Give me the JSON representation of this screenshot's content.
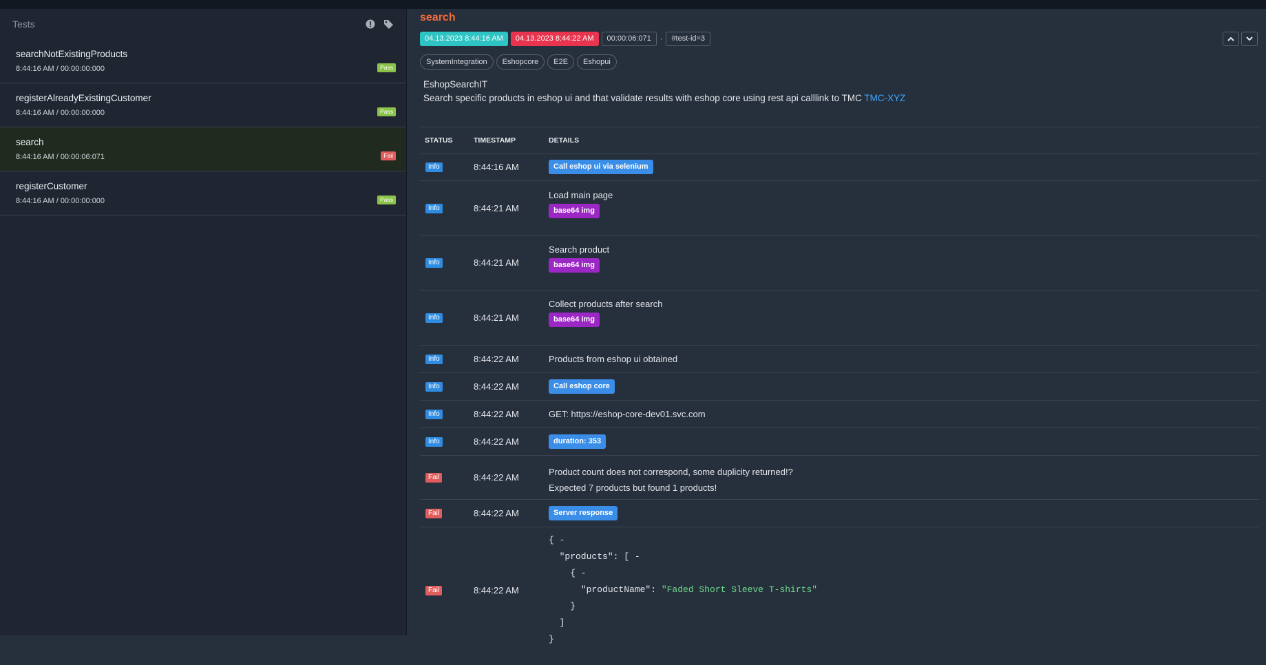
{
  "sidebar": {
    "title": "Tests",
    "icons": [
      "exclamation-circle-icon",
      "tag-icon"
    ],
    "tests": [
      {
        "name": "searchNotExistingProducts",
        "time": "8:44:16 AM / 00:00:00:000",
        "status": "Pass"
      },
      {
        "name": "registerAlreadyExistingCustomer",
        "time": "8:44:16 AM / 00:00:00:000",
        "status": "Pass"
      },
      {
        "name": "search",
        "time": "8:44:16 AM / 00:00:06:071",
        "status": "Fail"
      },
      {
        "name": "registerCustomer",
        "time": "8:44:16 AM / 00:00:00:000",
        "status": "Pass"
      }
    ]
  },
  "test": {
    "title": "search",
    "start": "04.13.2023 8:44:16 AM",
    "end": "04.13.2023 8:44:22 AM",
    "duration": "00:00:06:071",
    "separator": "·",
    "test_id": "#test-id=3",
    "tags": [
      "SystemIntegration",
      "Eshopcore",
      "E2E",
      "Eshopui"
    ],
    "class_name": "EshopSearchIT",
    "description": "Search specific products in eshop ui and that validate results with eshop core using rest api calllink to TMC ",
    "link_text": "TMC-XYZ"
  },
  "log": {
    "headers": {
      "status": "STATUS",
      "timestamp": "TIMESTAMP",
      "details": "DETAILS"
    },
    "rows": [
      {
        "status": "Info",
        "ts": "8:44:16 AM",
        "button": "Call eshop ui via selenium"
      },
      {
        "status": "Info",
        "ts": "8:44:21 AM",
        "text": "Load main page",
        "purple": "base64 img"
      },
      {
        "status": "Info",
        "ts": "8:44:21 AM",
        "text": "Search product",
        "purple": "base64 img"
      },
      {
        "status": "Info",
        "ts": "8:44:21 AM",
        "text": "Collect products after search",
        "purple": "base64 img"
      },
      {
        "status": "Info",
        "ts": "8:44:22 AM",
        "text": "Products from eshop ui obtained"
      },
      {
        "status": "Info",
        "ts": "8:44:22 AM",
        "button": "Call eshop core"
      },
      {
        "status": "Info",
        "ts": "8:44:22 AM",
        "text": "GET: https://eshop-core-dev01.svc.com"
      },
      {
        "status": "Info",
        "ts": "8:44:22 AM",
        "button": "duration: 353"
      },
      {
        "status": "Fail",
        "ts": "8:44:22 AM",
        "text": "Product count does not correspond, some duplicity returned!?",
        "text2": "Expected 7 products but found 1 products!"
      },
      {
        "status": "Fail",
        "ts": "8:44:22 AM",
        "button": "Server response"
      },
      {
        "status": "Fail",
        "ts": "8:44:22 AM",
        "json": {
          "l1": "{ -",
          "l2": "  \"products\": [ -",
          "l3": "    { -",
          "l4_key": "      \"productName\": ",
          "l4_val": "\"Faded Short Sleeve T-shirts\"",
          "l5": "    }",
          "l6": "  ]",
          "l7": "}"
        }
      }
    ]
  },
  "colors": {
    "accent": "#f26b3a",
    "pass": "#8bc34a",
    "fail": "#e05d5d",
    "info": "#2f8ce0",
    "link": "#3fa7ff"
  }
}
